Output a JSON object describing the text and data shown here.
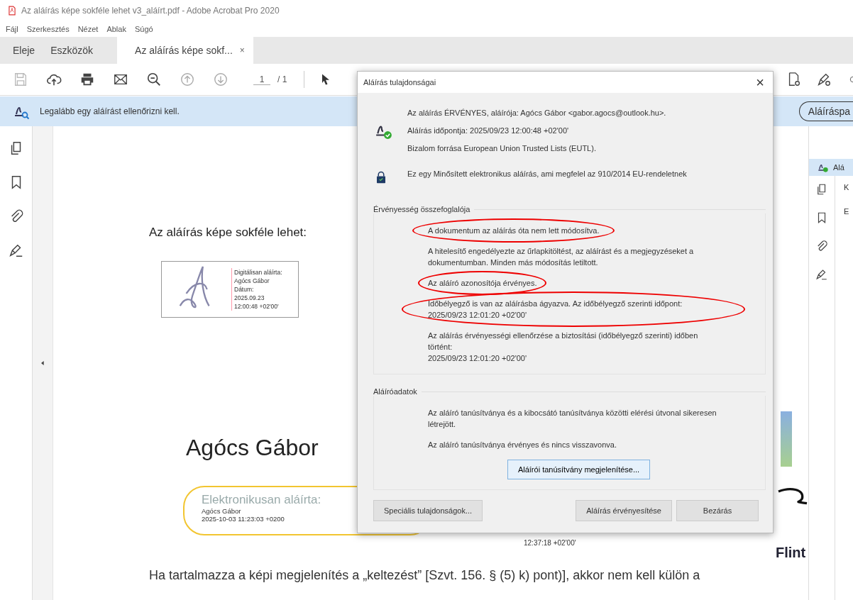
{
  "window": {
    "title": "Az aláírás képe sokféle lehet v3_aláírt.pdf - Adobe Acrobat Pro 2020"
  },
  "menu": [
    "Fájl",
    "Szerkesztés",
    "Nézet",
    "Ablak",
    "Súgó"
  ],
  "tabs": [
    {
      "label": "Eleje",
      "selected": false
    },
    {
      "label": "Eszközök",
      "selected": false
    },
    {
      "label": "Az aláírás képe sokf...",
      "selected": true,
      "close": "×"
    }
  ],
  "toolbar": {
    "page_current": "1",
    "page_total": "/ 1"
  },
  "notice": {
    "text": "Legalább egy aláírást ellenőrizni kell.",
    "button": "Aláíráspa"
  },
  "document": {
    "heading": "Az aláírás képe sokféle lehet:",
    "stamp": [
      "Digitálisan aláírta:",
      "Agócs Gábor",
      "Dátum:",
      "2025.09.23",
      "12:00:48 +02'00'"
    ],
    "name": "Agócs Gábor",
    "badge": {
      "title": "Elektronikusan aláírta:",
      "name": "Agócs Gábor",
      "date": "2025-10-03 11:23:03 +0200"
    },
    "time": "12:37:18 +02'00'",
    "logo": "Flint",
    "paragraph": [
      "Ha tartalmazza a képi megjelenítés a „keltezést” [Szvt. 156. § (5) k) pont)], akkor nem kell külön a"
    ]
  },
  "right_panel": {
    "header": "Alá",
    "items": [
      "K",
      "E"
    ]
  },
  "dialog": {
    "title": "Aláírás tulajdonságai",
    "close": "×",
    "summary": [
      "Az aláírás ÉRVÉNYES, aláírója: Agócs Gábor <gabor.agocs@outlook.hu>.",
      "Aláírás időpontja: 2025/09/23 12:00:48 +02'00'",
      "Bizalom forrása European Union Trusted Lists (EUTL)."
    ],
    "qualified": "Ez egy Minősített elektronikus aláírás, ami megfelel az 910/2014 EU-rendeletnek",
    "sections": [
      {
        "title": "Érvényesség összefoglalója",
        "lines": [
          {
            "text": "A dokumentum az aláírás óta nem lett módosítva.",
            "circled": true
          },
          {
            "text": "A hitelesítő engedélyezte az űrlapkitöltést, az aláírást és a megjegyzéseket a dokumentumban. Minden más módosítás letiltott.",
            "circled": false
          },
          {
            "text": "Az aláíró azonosítója érvényes.",
            "circled": true
          },
          {
            "text": "Időbélyegző is van az aláírásba ágyazva. Az időbélyegző szerinti időpont: 2025/09/23 12:01:20 +02'00'",
            "circled": true
          },
          {
            "text": "Az aláírás érvényességi ellenőrzése a biztosítási (időbélyegző szerinti) időben történt:\n2025/09/23 12:01:20 +02'00'",
            "circled": false
          }
        ]
      },
      {
        "title": "Aláíróadatok",
        "lines": [
          {
            "text": "Az aláíró tanúsítványa és a kibocsátó tanúsítványa közötti elérési útvonal sikeresen létrejött.",
            "circled": false
          },
          {
            "text": "Az aláíró tanúsítványa érvényes és nincs visszavonva.",
            "circled": false
          }
        ],
        "button": "Aláírói tanúsítvány megjelenítése..."
      }
    ],
    "buttons": [
      "Speciális tulajdonságok...",
      "Aláírás érvényesítése",
      "Bezárás"
    ]
  }
}
